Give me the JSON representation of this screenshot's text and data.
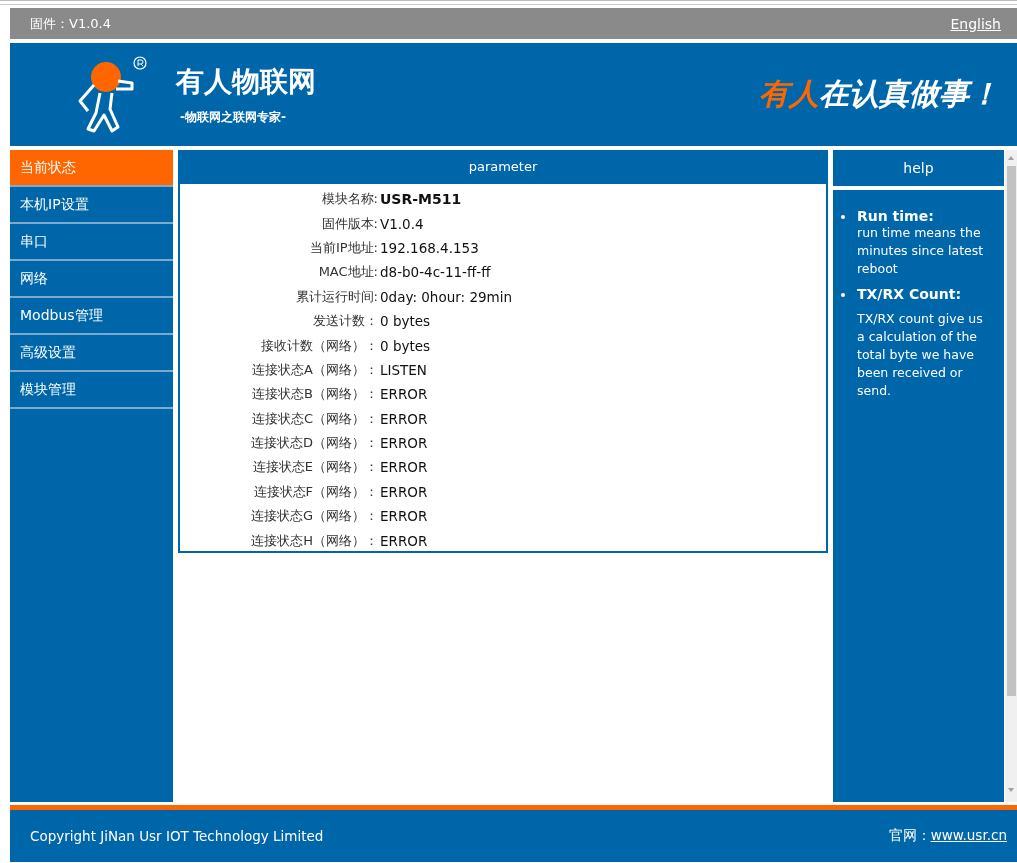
{
  "top_bar": {
    "firmware": "固件：V1.0.4",
    "language_link": "English"
  },
  "header": {
    "brand": "有人物联网",
    "tagline": "-物联网之联网专家-",
    "slogan_highlight": "有人",
    "slogan_rest": "在认真做事！"
  },
  "sidebar": {
    "items": [
      {
        "label": "当前状态",
        "selected": true
      },
      {
        "label": "本机IP设置",
        "selected": false
      },
      {
        "label": "串口",
        "selected": false
      },
      {
        "label": "网络",
        "selected": false
      },
      {
        "label": "Modbus管理",
        "selected": false
      },
      {
        "label": "高级设置",
        "selected": false
      },
      {
        "label": "模块管理",
        "selected": false
      }
    ]
  },
  "parameter": {
    "title": "parameter",
    "rows": [
      {
        "label": "模块名称:",
        "value": "USR-M511",
        "bold": true
      },
      {
        "label": "固件版本:",
        "value": "V1.0.4",
        "bold": false
      },
      {
        "label": "当前IP地址:",
        "value": "192.168.4.153",
        "bold": false
      },
      {
        "label": "MAC地址:",
        "value": "d8-b0-4c-11-ff-ff",
        "bold": false
      },
      {
        "label": "累计运行时间:",
        "value": "0day: 0hour: 29min",
        "bold": false
      },
      {
        "label": "发送计数：",
        "value": "0 bytes",
        "bold": false
      },
      {
        "label": "接收计数（网络）：",
        "value": "0 bytes",
        "bold": false
      },
      {
        "label": "连接状态A（网络）：",
        "value": "LISTEN",
        "bold": false
      },
      {
        "label": "连接状态B（网络）：",
        "value": "ERROR",
        "bold": false
      },
      {
        "label": "连接状态C（网络）：",
        "value": "ERROR",
        "bold": false
      },
      {
        "label": "连接状态D（网络）：",
        "value": "ERROR",
        "bold": false
      },
      {
        "label": "连接状态E（网络）：",
        "value": "ERROR",
        "bold": false
      },
      {
        "label": "连接状态F（网络）：",
        "value": "ERROR",
        "bold": false
      },
      {
        "label": "连接状态G（网络）：",
        "value": "ERROR",
        "bold": false
      },
      {
        "label": "连接状态H（网络）：",
        "value": "ERROR",
        "bold": false
      }
    ]
  },
  "help": {
    "title": "help",
    "items": [
      {
        "term": "Run time:",
        "text": "run time means the minutes since latest reboot"
      },
      {
        "term": "TX/RX Count:",
        "text": "TX/RX count give us a calculation of the total byte we have been received or send."
      }
    ]
  },
  "footer": {
    "copyright": "Copyright JiNan Usr IOT Technology Limited",
    "site_label": "官网：",
    "site_link": "www.usr.cn"
  }
}
